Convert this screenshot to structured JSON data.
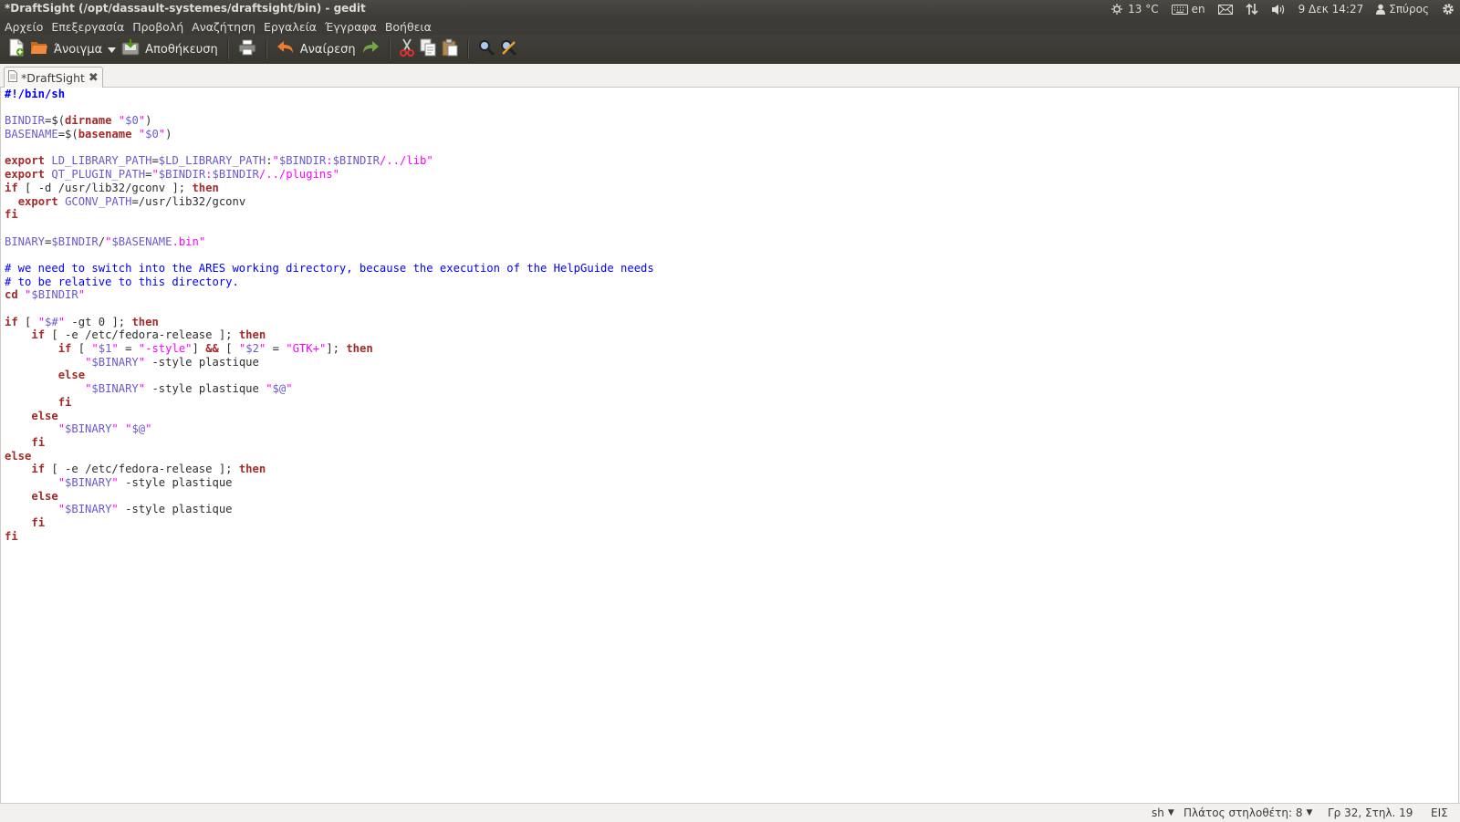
{
  "panel": {
    "window_title": "*DraftSight (/opt/dassault-systemes/draftsight/bin) - gedit",
    "weather": "13 °C",
    "keyboard_layout": "en",
    "clock": "9 Δεκ 14:27",
    "user": "Σπύρος"
  },
  "menu": [
    "Αρχείο",
    "Επεξεργασία",
    "Προβολή",
    "Αναζήτηση",
    "Εργαλεία",
    "Έγγραφα",
    "Βοήθεια"
  ],
  "toolbar": {
    "open_label": "Άνοιγμα",
    "save_label": "Αποθήκευση",
    "undo_label": "Αναίρεση"
  },
  "tab": {
    "title": "*DraftSight"
  },
  "editor": {
    "language": "sh",
    "selected_text": "-style plastique",
    "lines": [
      "#!/bin/sh",
      "",
      "BINDIR=$(dirname \"$0\")",
      "BASENAME=$(basename \"$0\")",
      "",
      "export LD_LIBRARY_PATH=$LD_LIBRARY_PATH:\"$BINDIR:$BINDIR/../lib\"",
      "export QT_PLUGIN_PATH=\"$BINDIR:$BINDIR/../plugins\"",
      "if [ -d /usr/lib32/gconv ]; then",
      "  export GCONV_PATH=/usr/lib32/gconv",
      "fi",
      "",
      "BINARY=$BINDIR/\"$BASENAME.bin\"",
      "",
      "# we need to switch into the ARES working directory, because the execution of the HelpGuide needs",
      "# to be relative to this directory.",
      "cd \"$BINDIR\"",
      "",
      "if [ \"$#\" -gt 0 ]; then",
      "    if [ -e /etc/fedora-release ]; then",
      "        if [ \"$1\" = \"-style\"] && [ \"$2\" = \"GTK+\"]; then",
      "            \"$BINARY\" -style plastique",
      "        else",
      "            \"$BINARY\" -style plastique \"$@\"",
      "        fi",
      "    else",
      "        \"$BINARY\" \"$@\"",
      "    fi",
      "else",
      "    if [ -e /etc/fedora-release ]; then",
      "        \"$BINARY\" -style plastique",
      "    else",
      "        \"$BINARY\" -style plastique",
      "    fi",
      "fi"
    ]
  },
  "status": {
    "language": "sh",
    "tab_width": "Πλάτος στηλοθέτη: 8",
    "position": "Γρ 32, Στηλ. 19",
    "mode": "ΕΙΣ"
  },
  "colors": {
    "keyword": "#a52a2a",
    "variable": "#6a5acd",
    "string": "#ff00ff",
    "comment": "#0000ff",
    "selection": "#f07746"
  }
}
